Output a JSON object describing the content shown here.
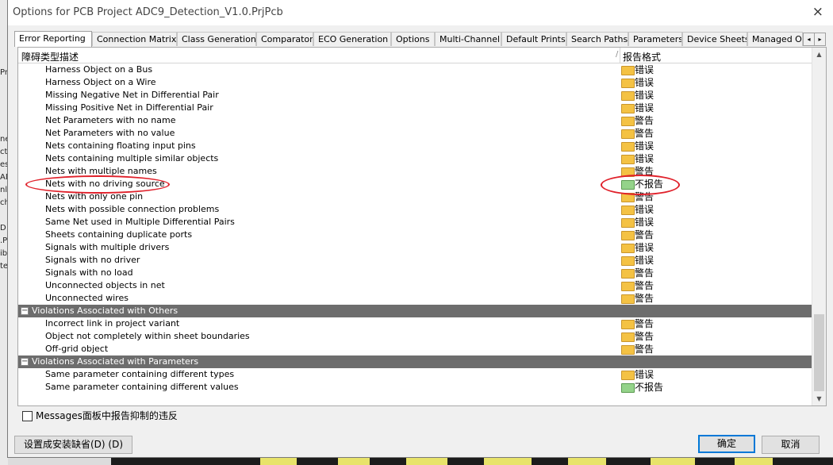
{
  "dialog": {
    "title": "Options for PCB Project ADC9_Detection_V1.0.PrjPcb"
  },
  "tabs": [
    "Error Reporting",
    "Connection Matrix",
    "Class Generation",
    "Comparator",
    "ECO Generation",
    "Options",
    "Multi-Channel",
    "Default Prints",
    "Search Paths",
    "Parameters",
    "Device Sheets",
    "Managed O"
  ],
  "columns": {
    "description": "障碍类型描述",
    "report_mode": "报告格式"
  },
  "rows": [
    {
      "type": "item",
      "label": "Harness Object on a Bus",
      "level": "错误",
      "icon": "yellow"
    },
    {
      "type": "item",
      "label": "Harness Object on a Wire",
      "level": "错误",
      "icon": "yellow"
    },
    {
      "type": "item",
      "label": "Missing Negative Net in Differential Pair",
      "level": "错误",
      "icon": "yellow"
    },
    {
      "type": "item",
      "label": "Missing Positive Net in Differential Pair",
      "level": "错误",
      "icon": "yellow"
    },
    {
      "type": "item",
      "label": "Net Parameters with no name",
      "level": "警告",
      "icon": "yellow"
    },
    {
      "type": "item",
      "label": "Net Parameters with no value",
      "level": "警告",
      "icon": "yellow"
    },
    {
      "type": "item",
      "label": "Nets containing floating input pins",
      "level": "错误",
      "icon": "yellow"
    },
    {
      "type": "item",
      "label": "Nets containing multiple similar objects",
      "level": "错误",
      "icon": "yellow"
    },
    {
      "type": "item",
      "label": "Nets with multiple names",
      "level": "警告",
      "icon": "yellow"
    },
    {
      "type": "item",
      "label": "Nets with no driving source",
      "level": "不报告",
      "icon": "green"
    },
    {
      "type": "item",
      "label": "Nets with only one pin",
      "level": "警告",
      "icon": "yellow"
    },
    {
      "type": "item",
      "label": "Nets with possible connection problems",
      "level": "错误",
      "icon": "yellow"
    },
    {
      "type": "item",
      "label": "Same Net used in Multiple Differential Pairs",
      "level": "错误",
      "icon": "yellow"
    },
    {
      "type": "item",
      "label": "Sheets containing duplicate ports",
      "level": "警告",
      "icon": "yellow"
    },
    {
      "type": "item",
      "label": "Signals with multiple drivers",
      "level": "错误",
      "icon": "yellow"
    },
    {
      "type": "item",
      "label": "Signals with no driver",
      "level": "错误",
      "icon": "yellow"
    },
    {
      "type": "item",
      "label": "Signals with no load",
      "level": "警告",
      "icon": "yellow"
    },
    {
      "type": "item",
      "label": "Unconnected objects in net",
      "level": "警告",
      "icon": "yellow"
    },
    {
      "type": "item",
      "label": "Unconnected wires",
      "level": "警告",
      "icon": "yellow"
    },
    {
      "type": "group",
      "label": "Violations Associated with Others",
      "toggle": "−"
    },
    {
      "type": "item",
      "label": "Incorrect link in project variant",
      "level": "警告",
      "icon": "yellow"
    },
    {
      "type": "item",
      "label": "Object not completely within sheet boundaries",
      "level": "警告",
      "icon": "yellow"
    },
    {
      "type": "item",
      "label": "Off-grid object",
      "level": "警告",
      "icon": "yellow"
    },
    {
      "type": "group",
      "label": "Violations Associated with Parameters",
      "toggle": "−"
    },
    {
      "type": "item",
      "label": "Same parameter containing different types",
      "level": "错误",
      "icon": "yellow"
    },
    {
      "type": "item",
      "label": "Same parameter containing different values",
      "level": "不报告",
      "icon": "green"
    }
  ],
  "checkbox_label": "Messages面板中报告抑制的违反",
  "buttons": {
    "set_default": "设置成安装缺省(D) (D)",
    "ok": "确定",
    "cancel": "取消"
  },
  "icons": {
    "close": "×",
    "tab_prev": "◂",
    "tab_next": "▸",
    "scroll_up": "▲",
    "scroll_down": "▼",
    "sort": "/"
  },
  "left_strip": [
    "Pr",
    "ne",
    "ct",
    "es",
    "AD",
    "nl",
    "ch",
    "D",
    ".P",
    "ib",
    "te"
  ],
  "colors": {
    "accent": "#0078d7",
    "annotation": "#e0202a",
    "folder_yellow": "#f4c244",
    "folder_green": "#94d38a",
    "group_header": "#6d6d6d"
  }
}
